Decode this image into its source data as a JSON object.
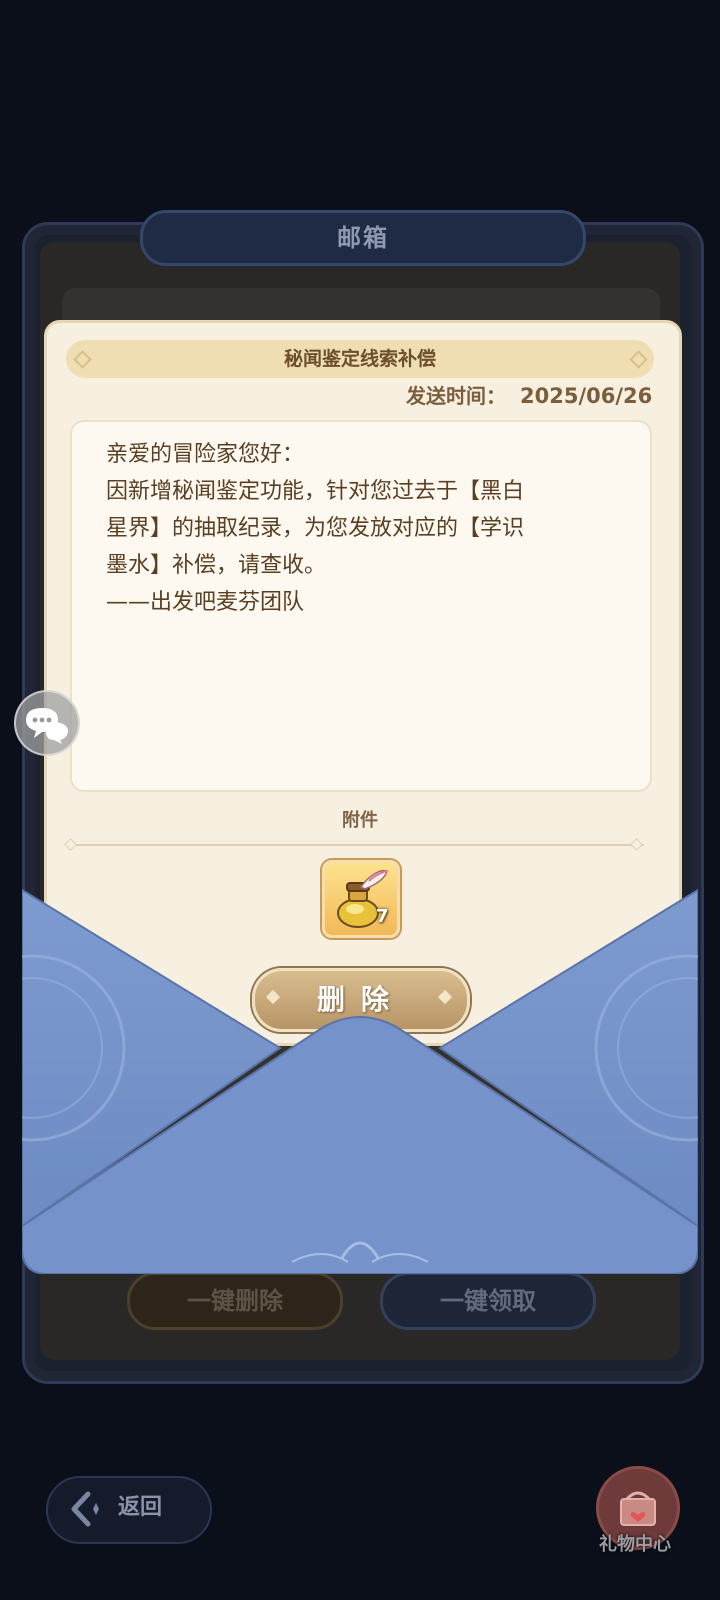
{
  "mailbox": {
    "title": "邮箱",
    "bulk_delete_label": "一键删除",
    "bulk_claim_label": "一键领取"
  },
  "mail": {
    "title": "秘闻鉴定线索补偿",
    "send_time_label": "发送时间：",
    "send_time_value": "2025/06/26",
    "body_lines": [
      "亲爱的冒险家您好：",
      "因新增秘闻鉴定功能，针对您过去于【黑白",
      "星界】的抽取纪录，为您发放对应的【学识",
      "墨水】补偿，请查收。",
      "——出发吧麦芬团队"
    ],
    "attachments_label": "附件",
    "attachment_item": {
      "icon": "ink-bottle-quill-icon",
      "count": "7"
    },
    "delete_label": "删除"
  },
  "bottom": {
    "back_label": "返回",
    "gift_center_label": "礼物中心"
  },
  "colors": {
    "envelope_blue": "#7895cb",
    "letter_bg": "#f7f0e0",
    "title_text": "#6d4f2d",
    "body_text": "#5a3f22",
    "button_gold": "#c6a678"
  }
}
